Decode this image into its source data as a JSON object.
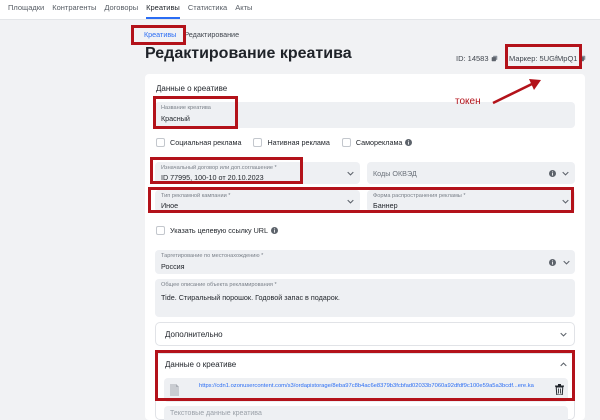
{
  "nav": {
    "items": [
      "Площадки",
      "Контрагенты",
      "Договоры",
      "Креативы",
      "Статистика",
      "Акты"
    ],
    "active_index": 3
  },
  "breadcrumb": {
    "parent": "Креативы",
    "current": "Редактирование"
  },
  "page": {
    "title": "Редактирование креатива",
    "id_text": "ID: 14583",
    "marker_text": "Маркер: 5UGfMpQ1"
  },
  "form": {
    "section_title": "Данные о креативе",
    "name": {
      "label": "Название креатива",
      "value": "Красный"
    },
    "checkboxes": [
      {
        "label": "Социальная реклама",
        "checked": false,
        "info": false
      },
      {
        "label": "Нативная реклама",
        "checked": false,
        "info": false
      },
      {
        "label": "Самореклама",
        "checked": false,
        "info": true
      }
    ],
    "contract": {
      "label": "Изначальный договор или доп.соглашение *",
      "value": "ID 77995, 100-10 от 20.10.2023"
    },
    "okved": {
      "placeholder": "Коды ОКВЭД"
    },
    "campaign_type": {
      "label": "Тип рекламной кампании *",
      "value": "Иное"
    },
    "ad_form": {
      "label": "Форма распространения рекламы *",
      "value": "Баннер"
    },
    "target_url_checkbox": {
      "label": "Указать целевую ссылку URL",
      "checked": false
    },
    "geo": {
      "label": "Таргетирование по местонахождению *",
      "value": "Россия"
    },
    "description": {
      "label": "Общее описание объекта рекламирования *",
      "value": "Tide. Стиральный порошок. Годовой запас в подарок."
    },
    "additional": {
      "title": "Дополнительно"
    },
    "creative_data": {
      "title": "Данные о креативе",
      "file_url": "https://cdn1.ozonusercontent.com/s3/ordapistorage/8eba97c8b4ac6e8379b3fcbfad02033b7060a92dfdf9c100e59a5a3bcdf...ere.ka",
      "text_placeholder": "Текстовые данные креатива"
    }
  },
  "annotation": {
    "token_label": "токен",
    "color": "#b3121a"
  },
  "colors": {
    "accent": "#2a6df4",
    "field_bg": "#eef0f3",
    "page_bg": "#f1f2f4"
  }
}
